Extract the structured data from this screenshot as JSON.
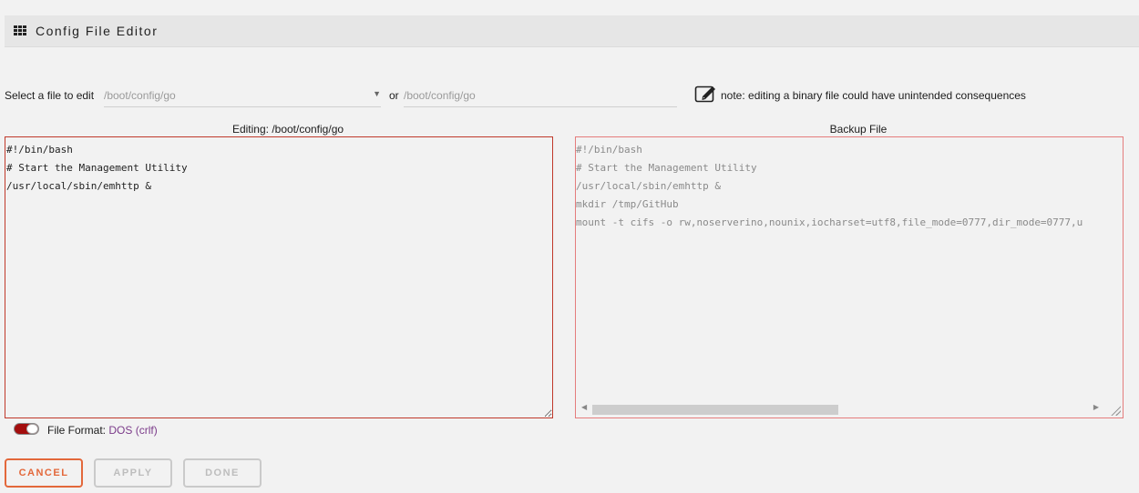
{
  "header": {
    "title": "Config File Editor",
    "icon": "grid-icon"
  },
  "file_select": {
    "label": "Select a file to edit",
    "selected": "/boot/config/go",
    "or_label": "or",
    "or_placeholder": "/boot/config/go",
    "note_icon": "edit-note-icon",
    "note": "note: editing a binary file could have unintended consequences"
  },
  "editor": {
    "label": "Editing: /boot/config/go",
    "content": "#!/bin/bash\n# Start the Management Utility\n/usr/local/sbin/emhttp &"
  },
  "backup": {
    "label": "Backup File",
    "content": "#!/bin/bash\n# Start the Management Utility\n/usr/local/sbin/emhttp &\nmkdir /tmp/GitHub\nmount -t cifs -o rw,noserverino,nounix,iocharset=utf8,file_mode=0777,dir_mode=0777,u"
  },
  "file_format": {
    "label": "File Format:",
    "value": "DOS (crlf)",
    "toggle_on": true
  },
  "buttons": {
    "cancel": "CANCEL",
    "apply": "APPLY",
    "done": "DONE"
  },
  "colors": {
    "accent": "#e3683b",
    "border_red": "#c0392b",
    "format_value": "#7b3b8a"
  }
}
